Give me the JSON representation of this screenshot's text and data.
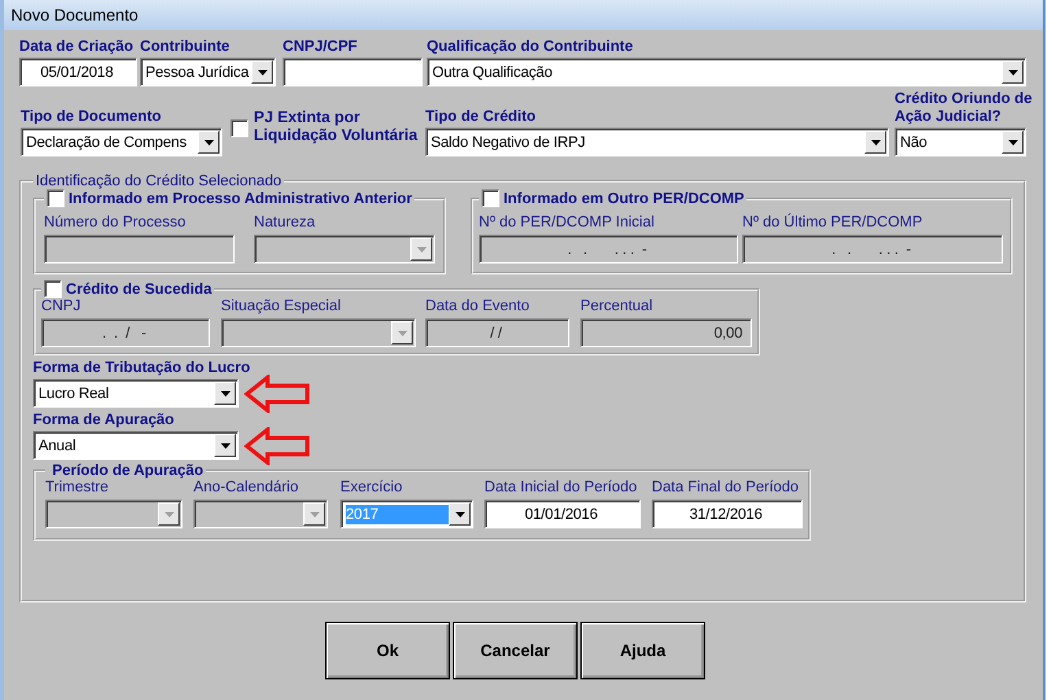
{
  "window": {
    "title": "Novo Documento"
  },
  "row1": [
    {
      "kind": "text",
      "label": "Data de Criação",
      "value": "05/01/2018",
      "disabled": false
    },
    {
      "kind": "combo",
      "label": "Contribuinte",
      "value": "Pessoa Jurídica",
      "disabled": false
    },
    {
      "kind": "text",
      "label": "CNPJ/CPF",
      "disabled": false
    },
    {
      "kind": "combo",
      "label": "Qualificação do Contribuinte",
      "value": "Outra Qualificação",
      "disabled": false
    }
  ],
  "row2": [
    {
      "kind": "combo",
      "label": "Tipo de Documento",
      "value": "Declaração de Compens",
      "disabled": false
    },
    {
      "kind": "checkbox",
      "label": "PJ Extinta por Liquidação Voluntária",
      "checked": false
    },
    {
      "kind": "combo",
      "label": "Tipo de Crédito",
      "value": "Saldo Negativo de IRPJ",
      "disabled": false
    },
    {
      "kind": "combo",
      "label": "Crédito Oriundo de Ação Judicial?",
      "value": "Não",
      "disabled": false
    }
  ],
  "identification": {
    "title": "Identificação do Crédito Selecionado",
    "groups": [
      {
        "title": "Informado em Processo Administrativo Anterior",
        "checked": false,
        "fields": [
          {
            "kind": "text",
            "label": "Número do Processo",
            "disabled": true
          },
          {
            "kind": "combo",
            "label": "Natureza",
            "disabled": true
          }
        ]
      },
      {
        "title": "Informado em Outro PER/DCOMP",
        "checked": false,
        "fields": [
          {
            "kind": "text",
            "label": "Nº do PER/DCOMP Inicial",
            "value": ".   .       . . .  -",
            "disabled": true
          },
          {
            "kind": "text",
            "label": "Nº do Último PER/DCOMP",
            "value": ".   .       . . .  -",
            "disabled": true
          }
        ]
      },
      {
        "title": "Crédito de Sucedida",
        "checked": false,
        "fields": [
          {
            "kind": "text",
            "label": "CNPJ",
            "value": ".  .  /   -",
            "disabled": true
          },
          {
            "kind": "combo",
            "label": "Situação Especial",
            "disabled": true
          },
          {
            "kind": "text",
            "label": "Data do Evento",
            "value": "/ /",
            "disabled": true
          },
          {
            "kind": "text",
            "label": "Percentual",
            "value": "0,00",
            "disabled": true
          }
        ]
      }
    ],
    "lucro": [
      {
        "kind": "combo",
        "label": "Forma de Tributação do Lucro",
        "value": "Lucro Real",
        "disabled": false,
        "arrow_marker": true
      },
      {
        "kind": "combo",
        "label": "Forma de Apuração",
        "value": "Anual",
        "disabled": false,
        "arrow_marker": true
      }
    ],
    "period": {
      "title": "Período de Apuração",
      "fields": [
        {
          "kind": "combo",
          "label": "Trimestre",
          "disabled": true,
          "focused": false
        },
        {
          "kind": "combo",
          "label": "Ano-Calendário",
          "disabled": true,
          "focused": false
        },
        {
          "kind": "combo",
          "label": "Exercício",
          "value": "2017",
          "disabled": false,
          "focused": true
        },
        {
          "kind": "text",
          "label": "Data Inicial do Período",
          "value": "01/01/2016",
          "disabled": false,
          "focused": false
        },
        {
          "kind": "text",
          "label": "Data Final do Período",
          "value": "31/12/2016",
          "disabled": false,
          "focused": false
        }
      ]
    }
  },
  "buttons": [
    {
      "label": "Ok"
    },
    {
      "label": "Cancelar"
    },
    {
      "label": "Ajuda"
    }
  ]
}
